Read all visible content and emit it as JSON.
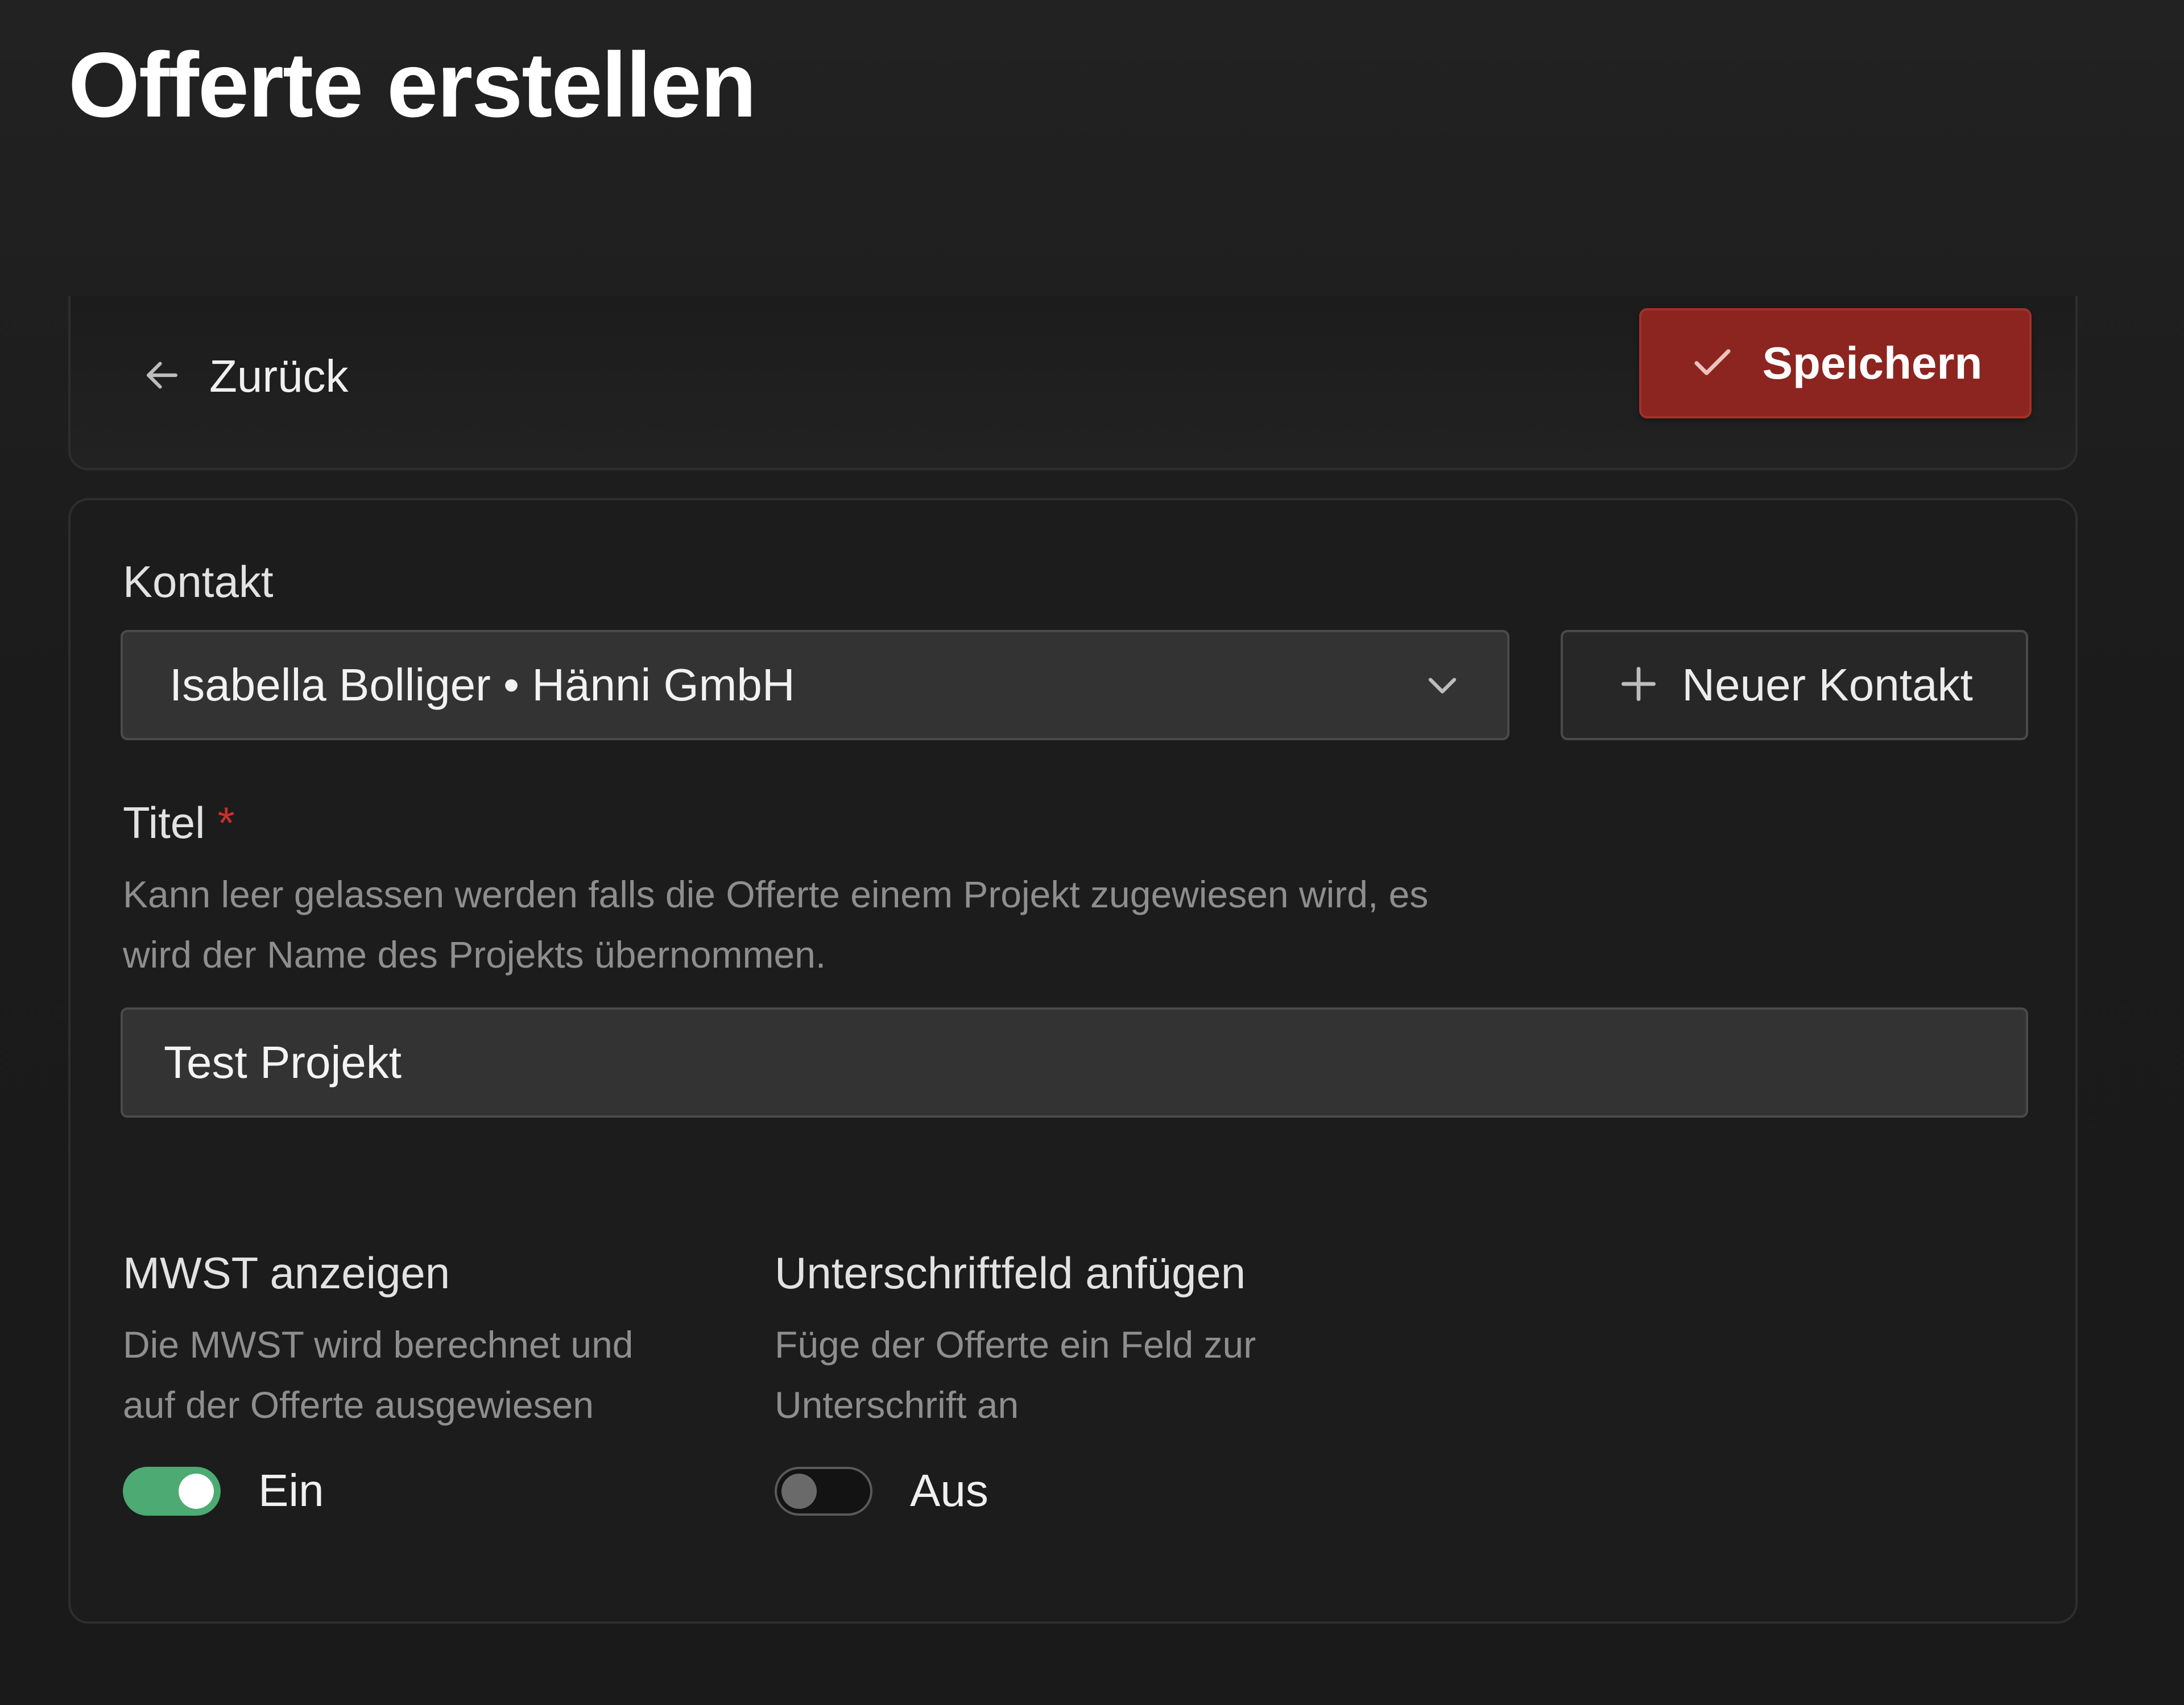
{
  "page": {
    "title": "Offerte erstellen"
  },
  "toolbar": {
    "back_label": "Zurück",
    "save_label": "Speichern"
  },
  "form": {
    "contact": {
      "label": "Kontakt",
      "selected_value": "Isabella Bolliger • Hänni GmbH",
      "new_contact_label": "Neuer Kontakt"
    },
    "title_field": {
      "label": "Titel",
      "required_marker": "*",
      "help_line1": "Kann leer gelassen werden falls die Offerte einem Projekt zugewiesen wird, es",
      "help_line2": "wird der Name des Projekts übernommen.",
      "value": "Test Projekt"
    },
    "vat": {
      "label": "MWST anzeigen",
      "help_line1": "Die MWST wird berechnet und",
      "help_line2": "auf der Offerte ausgewiesen",
      "state_label": "Ein",
      "enabled": true
    },
    "signature": {
      "label": "Unterschriftfeld anfügen",
      "help_line1": "Füge der Offerte ein Feld zur",
      "help_line2": "Unterschrift an",
      "state_label": "Aus",
      "enabled": false
    }
  },
  "colors": {
    "accent_save": "#8c2520",
    "toggle_on": "#4caa72",
    "required": "#c9302c",
    "background": "#1a1a1a"
  },
  "icons": {
    "back": "arrow-left-icon",
    "save": "check-icon",
    "dropdown": "chevron-down-icon",
    "add": "plus-icon"
  }
}
